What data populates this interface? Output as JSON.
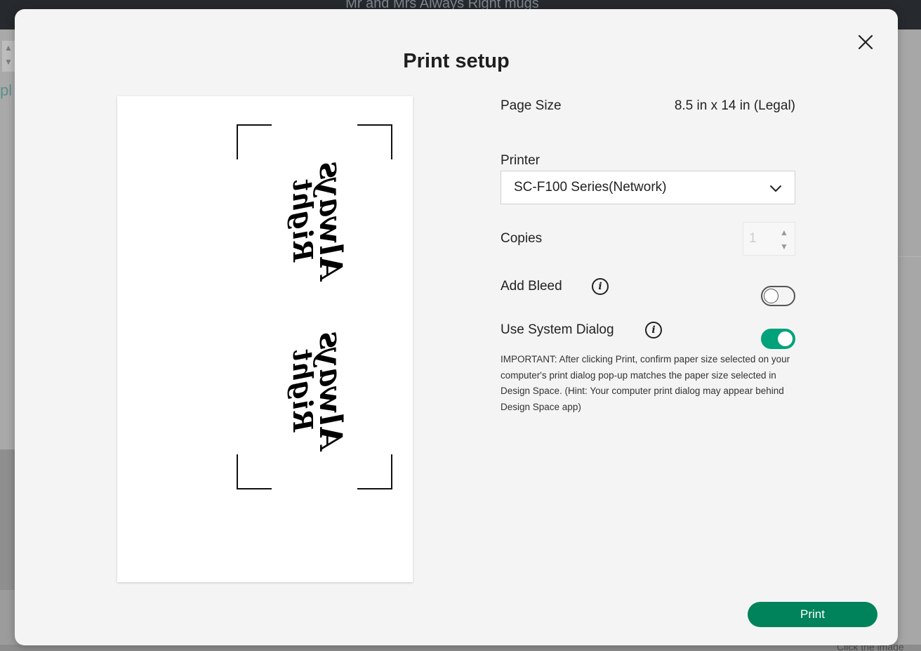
{
  "app": {
    "title": "Mr and Mrs Always Right mugs",
    "side_fragment": "pl",
    "bottom_fragment": "Click the image"
  },
  "modal": {
    "title": "Print setup",
    "close_icon": "close-icon"
  },
  "preview": {
    "artwork": [
      {
        "line1": "Always",
        "line2": "Right"
      },
      {
        "line1": "Always",
        "line2": "Right"
      }
    ]
  },
  "settings": {
    "page_size_label": "Page Size",
    "page_size_value": "8.5 in x 14 in (Legal)",
    "printer_label": "Printer",
    "printer_value": "SC-F100 Series(Network)",
    "copies_label": "Copies",
    "copies_value": "1",
    "add_bleed_label": "Add Bleed",
    "add_bleed_on": false,
    "system_dialog_label": "Use System Dialog",
    "system_dialog_on": true,
    "note": "IMPORTANT: After clicking Print, confirm paper size selected on your computer's print dialog pop-up matches the paper size selected in Design Space. (Hint: Your computer print dialog may appear behind Design Space app)"
  },
  "actions": {
    "print_label": "Print"
  },
  "colors": {
    "accent": "#00835a",
    "toggle_on": "#00a27a"
  }
}
